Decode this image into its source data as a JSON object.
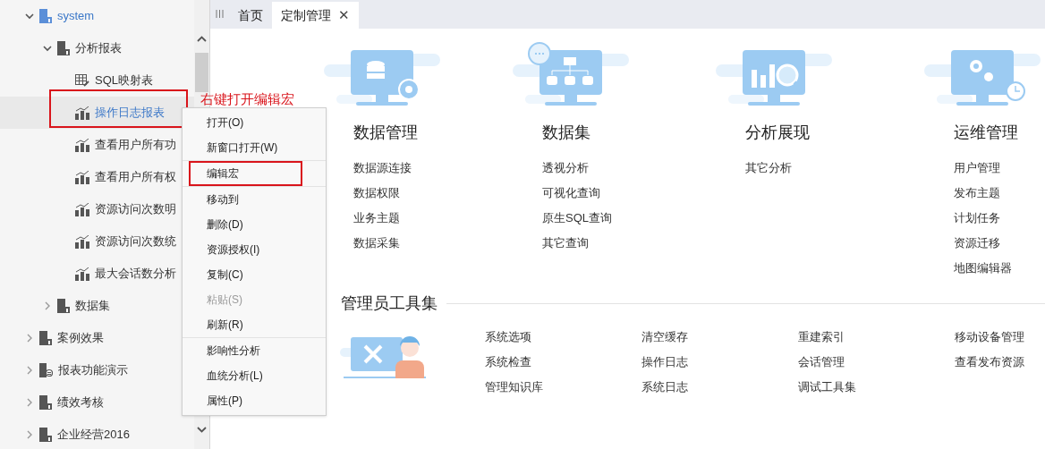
{
  "tree": [
    {
      "label": "system",
      "kind": "system-folder",
      "expanded": true,
      "selected": false,
      "children": [
        {
          "label": "分析报表",
          "kind": "folder",
          "expanded": true,
          "selected": false,
          "children": [
            {
              "label": "SQL映射表",
              "kind": "table",
              "selected": false
            },
            {
              "label": "操作日志报表",
              "kind": "report",
              "selected": true,
              "annotated": true
            },
            {
              "label": "查看用户所有功",
              "kind": "report",
              "selected": false
            },
            {
              "label": "查看用户所有权",
              "kind": "report",
              "selected": false
            },
            {
              "label": "资源访问次数明",
              "kind": "report",
              "selected": false
            },
            {
              "label": "资源访问次数统",
              "kind": "report",
              "selected": false
            },
            {
              "label": "最大会话数分析",
              "kind": "report",
              "selected": false
            }
          ]
        },
        {
          "label": "数据集",
          "kind": "folder",
          "expanded": false,
          "selected": false
        }
      ]
    },
    {
      "label": "案例效果",
      "kind": "folder",
      "expanded": false,
      "selected": false
    },
    {
      "label": "报表功能演示",
      "kind": "theme-folder",
      "expanded": false,
      "selected": false
    },
    {
      "label": "绩效考核",
      "kind": "folder",
      "expanded": false,
      "selected": false
    },
    {
      "label": "企业经营2016",
      "kind": "folder",
      "expanded": false,
      "selected": false
    }
  ],
  "annotation": {
    "text": "右键打开编辑宏"
  },
  "context_menu": [
    [
      {
        "label": "打开(O)",
        "disabled": false
      },
      {
        "label": "新窗口打开(W)",
        "disabled": false
      }
    ],
    [
      {
        "label": "编辑宏",
        "disabled": false,
        "annotated": true
      }
    ],
    [
      {
        "label": "移动到",
        "disabled": false
      },
      {
        "label": "删除(D)",
        "disabled": false
      },
      {
        "label": "资源授权(I)",
        "disabled": false
      },
      {
        "label": "复制(C)",
        "disabled": false
      },
      {
        "label": "粘贴(S)",
        "disabled": true
      },
      {
        "label": "刷新(R)",
        "disabled": false
      }
    ],
    [
      {
        "label": "影响性分析",
        "disabled": false
      },
      {
        "label": "血统分析(L)",
        "disabled": false
      },
      {
        "label": "属性(P)",
        "disabled": false
      }
    ]
  ],
  "tabs": [
    {
      "label": "首页",
      "selected": false,
      "closable": false
    },
    {
      "label": "定制管理",
      "selected": true,
      "closable": true
    }
  ],
  "close_glyph": "✕",
  "cards": [
    {
      "title": "数据管理",
      "links": [
        "数据源连接",
        "数据权限",
        "业务主题",
        "数据采集"
      ]
    },
    {
      "title": "数据集",
      "links": [
        "透视分析",
        "可视化查询",
        "原生SQL查询",
        "其它查询"
      ]
    },
    {
      "title": "分析展现",
      "links": [
        "其它分析"
      ]
    },
    {
      "title": "运维管理",
      "links": [
        "用户管理",
        "发布主题",
        "计划任务",
        "资源迁移",
        "地图编辑器"
      ]
    }
  ],
  "admin_tools": {
    "title": "管理员工具集",
    "columns": [
      [
        "系统选项",
        "系统检查",
        "管理知识库"
      ],
      [
        "清空缓存",
        "操作日志",
        "系统日志"
      ],
      [
        "重建索引",
        "会话管理",
        "调试工具集"
      ],
      [
        "移动设备管理",
        "查看发布资源"
      ]
    ]
  }
}
